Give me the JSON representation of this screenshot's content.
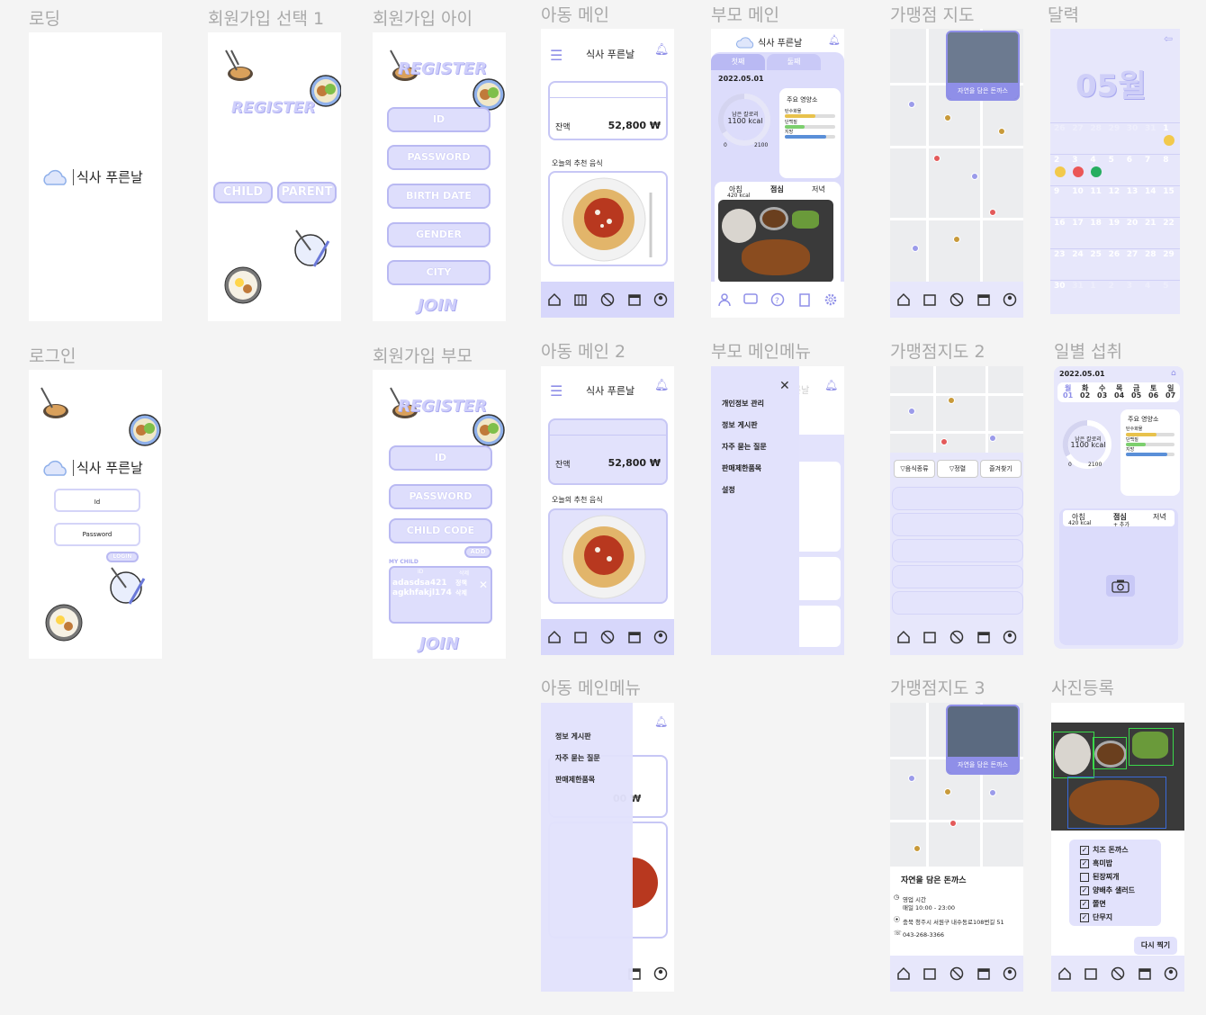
{
  "titles": {
    "loading": "로딩",
    "signup_select": "회원가입 선택 1",
    "signup_child": "회원가입 아이",
    "child_main": "아동 메인",
    "parent_main": "부모 메인",
    "store_map": "가맹점 지도",
    "calendar": "달력",
    "login": "로그인",
    "signup_parent": "회원가입 부모",
    "child_main2": "아동 메인 2",
    "parent_menu": "부모 메인메뉴",
    "store_map2": "가맹점지도 2",
    "daily_intake": "일별 섭취",
    "child_menu": "아동 메인메뉴",
    "store_map3": "가맹점지도 3",
    "photo_register": "사진등록"
  },
  "brand": {
    "name": "식사 푸른날",
    "accent": "#8f8fe8",
    "lavender": "#dcdcfb"
  },
  "register": {
    "word": "REGISTER",
    "child_btn": "CHILD",
    "parent_btn": "PARENT",
    "fields_child": [
      "ID",
      "PASSWORD",
      "BIRTH DATE",
      "GENDER",
      "CITY"
    ],
    "join": "JOIN",
    "fields_parent": [
      "ID",
      "PASSWORD",
      "CHILD CODE"
    ],
    "add": "ADD",
    "my_child": "MY CHILD",
    "child_table_header": [
      "ID",
      "삭제"
    ],
    "child_ids": [
      "adasdsa421",
      "agkhfakjl174"
    ],
    "child_actions": [
      "정책",
      "삭제"
    ]
  },
  "login": {
    "id_placeholder": "Id",
    "password_placeholder": "Password",
    "login_btn": "LOGIN"
  },
  "child_main": {
    "balance_label": "잔액",
    "balance_value": "52,800 ₩",
    "recommend_label": "오늘의 추천 음식"
  },
  "parent_main": {
    "tabs": [
      "첫째",
      "둘째"
    ],
    "date": "2022.05.01",
    "remaining_label": "남은 칼로리",
    "remaining_value": "1100 kcal",
    "gauge_min": "0",
    "gauge_max": "2100",
    "nutrients_title": "주요 영양소",
    "nutrients": [
      "탄수화물",
      "단백질",
      "지방"
    ],
    "meals": [
      "아침",
      "점심",
      "저녁"
    ],
    "breakfast_kcal": "420 kcal"
  },
  "store": {
    "name": "자연을 담은 돈까스",
    "filters": [
      "▽음식종류",
      "▽정렬",
      "즐겨찾기"
    ],
    "hours_label": "영업 시간",
    "hours_value": "매일 10:00 - 23:00",
    "address": "충북 청주시 서원구 내수동로108번길 51",
    "phone": "043-268-3366"
  },
  "calendar": {
    "month": "05월",
    "weeks": [
      [
        "26",
        "27",
        "28",
        "29",
        "30",
        "31",
        "1"
      ],
      [
        "2",
        "3",
        "4",
        "5",
        "6",
        "7",
        "8"
      ],
      [
        "9",
        "10",
        "11",
        "12",
        "13",
        "14",
        "15"
      ],
      [
        "16",
        "17",
        "18",
        "19",
        "20",
        "21",
        "22"
      ],
      [
        "23",
        "24",
        "25",
        "26",
        "27",
        "28",
        "29"
      ],
      [
        "30",
        "31",
        "1",
        "2",
        "3",
        "4",
        "5"
      ]
    ]
  },
  "parent_menu": {
    "items": [
      "개인정보 관리",
      "정보 게시판",
      "자주 묻는 질문",
      "판매제한품목",
      "설정"
    ]
  },
  "child_menu": {
    "items": [
      "정보 게시판",
      "자주 묻는 질문",
      "판매제한품목"
    ]
  },
  "daily": {
    "date": "2022.05.01",
    "weekdays": [
      "월",
      "화",
      "수",
      "목",
      "금",
      "토",
      "일"
    ],
    "days": [
      "01",
      "02",
      "03",
      "04",
      "05",
      "06",
      "07"
    ],
    "lunch_sub": "+ 추가"
  },
  "photo": {
    "items": [
      "치즈 돈까스",
      "흑미밥",
      "된장찌개",
      "양배추 샐러드",
      "쫄면",
      "단무지"
    ],
    "checked": [
      true,
      true,
      false,
      true,
      true,
      true
    ],
    "retake": "다시 찍기"
  }
}
